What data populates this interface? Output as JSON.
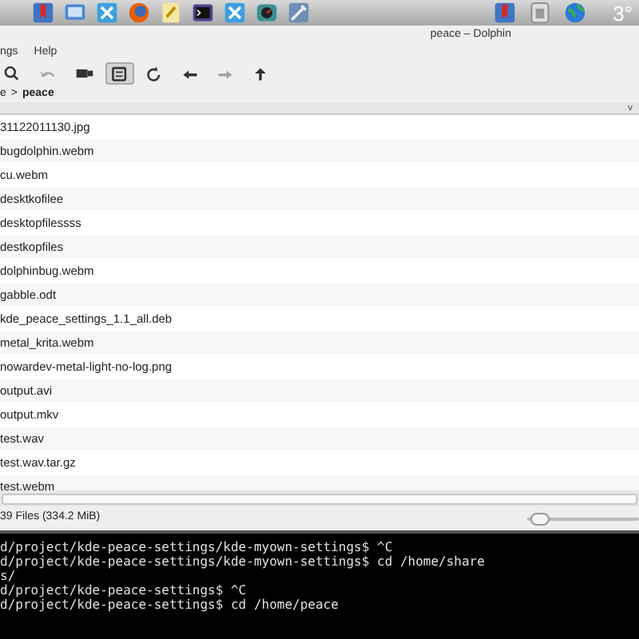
{
  "taskbar": {
    "launchers": [
      {
        "kind": "bookmark"
      },
      {
        "kind": "monitor"
      },
      {
        "kind": "blue"
      },
      {
        "kind": "firefox"
      },
      {
        "kind": "notes"
      },
      {
        "kind": "terminal"
      },
      {
        "kind": "blue"
      },
      {
        "kind": "gauge"
      },
      {
        "kind": "tools"
      }
    ],
    "tray": [
      {
        "kind": "bookmark"
      },
      {
        "kind": "trash"
      },
      {
        "kind": "globe"
      }
    ],
    "temperature": "3°"
  },
  "window": {
    "title": "peace – Dolphin"
  },
  "menu": [
    "ngs",
    "Help"
  ],
  "toolbar": [
    {
      "kind": "search",
      "disabled": false,
      "selected": false
    },
    {
      "kind": "undo",
      "disabled": true,
      "selected": false
    },
    {
      "kind": "view",
      "disabled": false,
      "selected": false
    },
    {
      "kind": "preview",
      "disabled": false,
      "selected": true
    },
    {
      "kind": "reload",
      "disabled": false,
      "selected": false
    },
    {
      "kind": "back",
      "disabled": false,
      "selected": false
    },
    {
      "kind": "forward",
      "disabled": true,
      "selected": false
    },
    {
      "kind": "up",
      "disabled": false,
      "selected": false
    }
  ],
  "breadcrumb": [
    "e",
    ">",
    "peace"
  ],
  "header": {
    "sort_indicator": "v"
  },
  "files": [
    "31122011130.jpg",
    "bugdolphin.webm",
    "cu.webm",
    "desktkofilee",
    "desktopfilessss",
    "destkopfiles",
    "dolphinbug.webm",
    "gabble.odt",
    "kde_peace_settings_1.1_all.deb",
    "metal_krita.webm",
    "nowardev-metal-light-no-log.png",
    "output.avi",
    "output.mkv",
    "test.wav",
    "test.wav.tar.gz",
    "test.webm"
  ],
  "status_bar": {
    "text": "39 Files (334.2 MiB)",
    "zoom": {
      "level": 0.12
    }
  },
  "terminal": {
    "lines": [
      "d/project/kde-peace-settings/kde-myown-settings$ ^C",
      "d/project/kde-peace-settings/kde-myown-settings$ cd /home/share",
      "s/",
      "d/project/kde-peace-settings$ ^C",
      "d/project/kde-peace-settings$ cd /home/peace"
    ]
  }
}
